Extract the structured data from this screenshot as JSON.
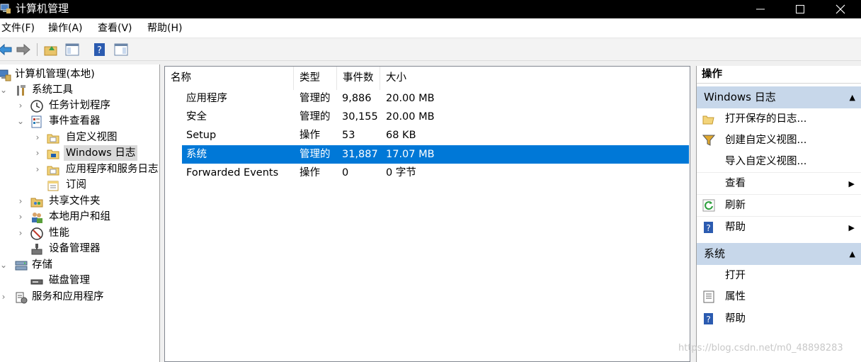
{
  "window": {
    "title": "计算机管理"
  },
  "menu": {
    "items": [
      "文件(F)",
      "操作(A)",
      "查看(V)",
      "帮助(H)"
    ]
  },
  "toolbar": {
    "buttons": [
      "back-icon",
      "forward-icon",
      "up-folder-icon",
      "show-hide-console-tree-icon",
      "help-icon",
      "show-action-pane-icon"
    ]
  },
  "tree": {
    "items": [
      {
        "label": "计算机管理(本地)",
        "icon": "computer-management-icon",
        "expanded": true
      },
      {
        "label": "系统工具",
        "icon": "system-tools-icon",
        "expanded": true
      },
      {
        "label": "任务计划程序",
        "icon": "clock-icon",
        "expanded": false
      },
      {
        "label": "事件查看器",
        "icon": "event-viewer-icon",
        "expanded": true
      },
      {
        "label": "自定义视图",
        "icon": "folder-icon",
        "expanded": false
      },
      {
        "label": "Windows 日志",
        "icon": "folder-icon",
        "expanded": false,
        "selected": true
      },
      {
        "label": "应用程序和服务日志",
        "icon": "folder-icon",
        "expanded": false
      },
      {
        "label": "订阅",
        "icon": "subscriptions-icon"
      },
      {
        "label": "共享文件夹",
        "icon": "shared-folder-icon",
        "expanded": false
      },
      {
        "label": "本地用户和组",
        "icon": "users-icon",
        "expanded": false
      },
      {
        "label": "性能",
        "icon": "performance-icon",
        "expanded": false
      },
      {
        "label": "设备管理器",
        "icon": "device-manager-icon"
      },
      {
        "label": "存储",
        "icon": "storage-icon",
        "expanded": true
      },
      {
        "label": "磁盘管理",
        "icon": "disk-icon"
      },
      {
        "label": "服务和应用程序",
        "icon": "services-icon",
        "expanded": false
      }
    ]
  },
  "list": {
    "columns": [
      "名称",
      "类型",
      "事件数",
      "大小"
    ],
    "rows": [
      {
        "name": "应用程序",
        "type": "管理的",
        "count": "9,886",
        "size": "20.00 MB"
      },
      {
        "name": "安全",
        "type": "管理的",
        "count": "30,155",
        "size": "20.00 MB"
      },
      {
        "name": "Setup",
        "type": "操作",
        "count": "53",
        "size": "68 KB"
      },
      {
        "name": "系统",
        "type": "管理的",
        "count": "31,887",
        "size": "17.07 MB",
        "selected": true
      },
      {
        "name": "Forwarded Events",
        "type": "操作",
        "count": "0",
        "size": "0 字节"
      }
    ]
  },
  "actions": {
    "title": "操作",
    "sections": [
      {
        "header": "Windows 日志",
        "items": [
          {
            "label": "打开保存的日志...",
            "icon": "open-log-icon"
          },
          {
            "label": "创建自定义视图...",
            "icon": "filter-icon"
          },
          {
            "label": "导入自定义视图...",
            "icon": ""
          },
          {
            "label": "查看",
            "icon": "",
            "submenu": true
          },
          {
            "label": "刷新",
            "icon": "refresh-icon"
          },
          {
            "label": "帮助",
            "icon": "help-icon",
            "submenu": true
          }
        ]
      },
      {
        "header": "系统",
        "items": [
          {
            "label": "打开",
            "icon": ""
          },
          {
            "label": "属性",
            "icon": "properties-icon"
          },
          {
            "label": "帮助",
            "icon": "help-icon"
          }
        ]
      }
    ]
  },
  "watermark": "https://blog.csdn.net/m0_48898283",
  "colors": {
    "selection": "#0078d7",
    "section_header": "#c7d7ea",
    "titlebar": "#000000"
  }
}
